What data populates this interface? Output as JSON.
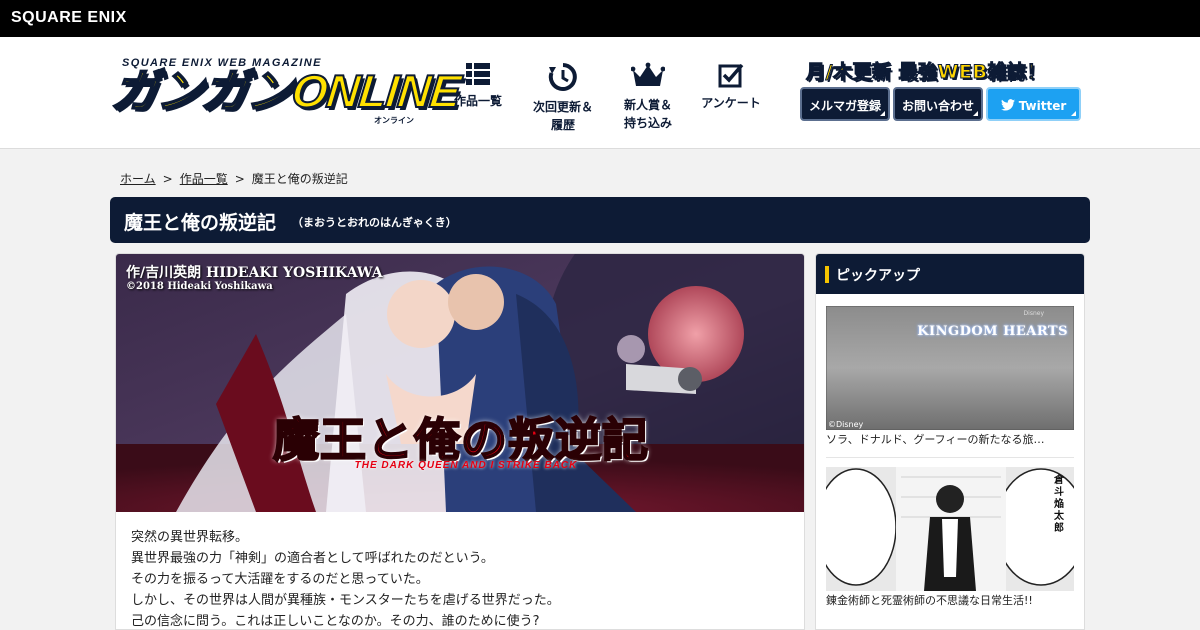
{
  "brand": {
    "company": "SQUARE ENIX"
  },
  "site_logo": {
    "subtitle": "SQUARE ENIX WEB MAGAZINE",
    "main": "ガンガンONLINE",
    "kana": "オンライン"
  },
  "nav": [
    {
      "label": "作品一覧",
      "icon": "grid-list-icon"
    },
    {
      "label": "次回更新＆\n履歴",
      "icon": "history-clock-icon"
    },
    {
      "label": "新人賞＆\n持ち込み",
      "icon": "crown-icon"
    },
    {
      "label": "アンケート",
      "icon": "checkbox-icon"
    }
  ],
  "header_promo": {
    "tagline": "月/木更新 最強WEB雑誌！",
    "newsletter_label": "メルマガ登録",
    "contact_label": "お問い合わせ",
    "twitter_label": "Twitter"
  },
  "breadcrumb": {
    "home": "ホーム",
    "works": "作品一覧",
    "current": "魔王と俺の叛逆記",
    "separator": ">"
  },
  "title": {
    "main": "魔王と俺の叛逆記",
    "reading": "（まおうとおれのはんぎゃくき）"
  },
  "banner": {
    "credit": "作/吉川英朗 HIDEAKI YOSHIKAWA",
    "copyright": "©2018 Hideaki Yoshikawa",
    "logo_text": "魔王と俺の叛逆記",
    "logo_subtitle": "THE DARK QUEEN AND I STRIKE BACK"
  },
  "synopsis": [
    "突然の異世界転移。",
    "異世界最強の力「神剣」の適合者として呼ばれたのだという。",
    "その力を振るって大活躍をするのだと思っていた。",
    "しかし、その世界は人間が異種族・モンスターたちを虐げる世界だった。",
    "己の信念に問う。これは正しいことなのか。その力、誰のために使う?"
  ],
  "sidebar": {
    "heading": "ピックアップ",
    "items": [
      {
        "caption": "ソラ、ドナルド、グーフィーの新たなる旅…",
        "image_logo": "KINGDOM HEARTS",
        "image_small": "Disney",
        "image_mark": "©Disney"
      },
      {
        "caption": "錬金術師と死霊術師の不思議な日常生活!!",
        "image_name": "倉斗焔太郎"
      }
    ]
  },
  "colors": {
    "navy": "#0d1b35",
    "yellow": "#ffe100",
    "twitter": "#1da1f2",
    "title_red": "#e60012"
  }
}
